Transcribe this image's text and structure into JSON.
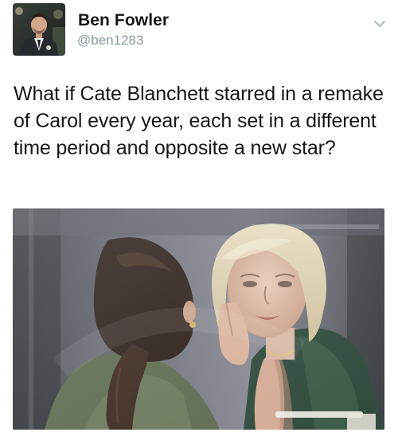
{
  "tweet": {
    "author": {
      "display_name": "Ben Fowler",
      "handle": "@ben1283",
      "avatar_icon": "profile-photo"
    },
    "text": "What if Cate Blanchett starred in a remake of Carol every year, each set in a different time period and opposite a new star?",
    "menu_icon": "chevron-down-icon",
    "media": {
      "type": "photo"
    }
  },
  "colors": {
    "text": "#14171a",
    "secondary_text": "#8899a6",
    "caret": "#aab8c2"
  }
}
